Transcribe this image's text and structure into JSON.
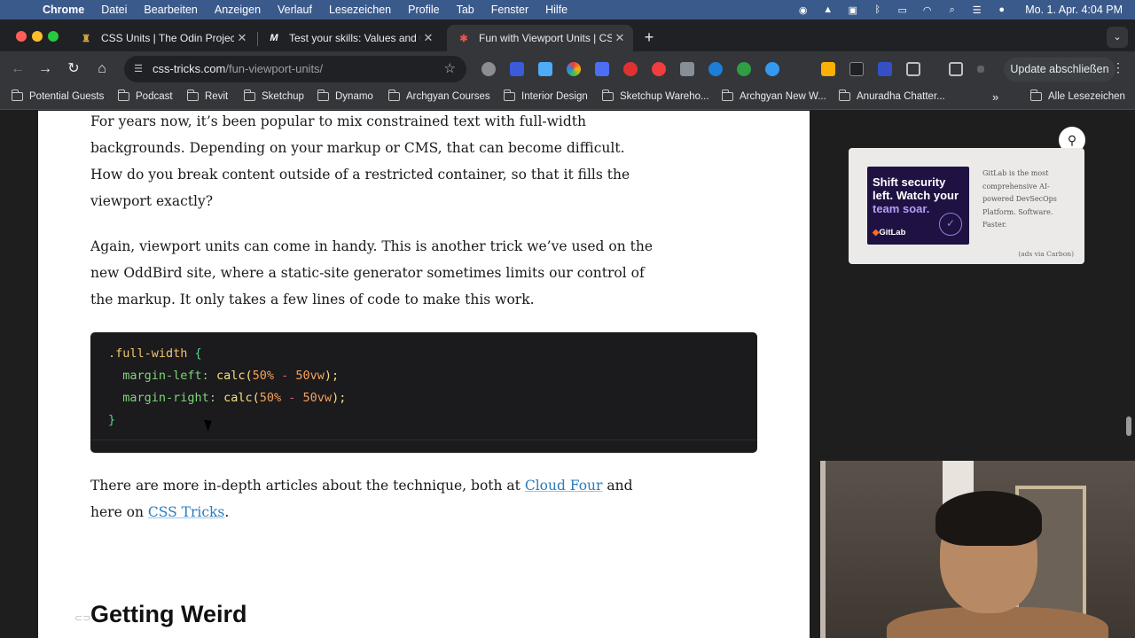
{
  "menubar": {
    "app": "Chrome",
    "items": [
      "Datei",
      "Bearbeiten",
      "Anzeigen",
      "Verlauf",
      "Lesezeichen",
      "Profile",
      "Tab",
      "Fenster",
      "Hilfe"
    ],
    "clock": "Mo. 1. Apr.  4:04 PM"
  },
  "tabs": [
    {
      "title": "CSS Units | The Odin Project",
      "favicon": "odin-icon",
      "active": false
    },
    {
      "title": "Test your skills: Values and ur",
      "favicon": "mdn-icon",
      "active": false
    },
    {
      "title": "Fun with Viewport Units | CSS",
      "favicon": "css-tricks-icon",
      "active": true
    }
  ],
  "toolbar": {
    "url_host": "css-tricks.com",
    "url_path": "/fun-viewport-units/",
    "update_label": "Update abschließen"
  },
  "bookmarks": [
    "Potential Guests",
    "Podcast",
    "Revit",
    "Sketchup",
    "Dynamo",
    "Archgyan Courses",
    "Interior Design",
    "Sketchup Wareho...",
    "Archgyan New W...",
    "Anuradha Chatter..."
  ],
  "bookmarks_all": "Alle Lesezeichen",
  "article": {
    "p1": "For years now, it’s been popular to mix constrained text with full-width backgrounds. Depending on your markup or CMS, that can become difficult. How do you break content outside of a restricted container, so that it fills the viewport exactly?",
    "p2": "Again, viewport units can come in handy. This is another trick we’ve used on the new OddBird site, where a static-site generator sometimes limits our control of the markup. It only takes a few lines of code to make this work.",
    "code": {
      "selector": ".full-width",
      "open": "{",
      "close": "}",
      "prop1": "margin-left",
      "prop2": "margin-right",
      "fn": "calc",
      "a": "50%",
      "op": "-",
      "b": "50vw"
    },
    "p3_before": "There are more in-depth articles about the technique, both at ",
    "p3_link1": "Cloud Four",
    "p3_mid": " and here on ",
    "p3_link2": "CSS Tricks",
    "p3_after": ".",
    "heading": "Getting Weird"
  },
  "ad": {
    "headline_1": "Shift security left. Watch your",
    "headline_2": "team soar.",
    "brand": "GitLab",
    "text": "GitLab is the most comprehensive AI-powered DevSecOps Platform. Software. Faster.",
    "via": "(ads via Carbon)"
  }
}
